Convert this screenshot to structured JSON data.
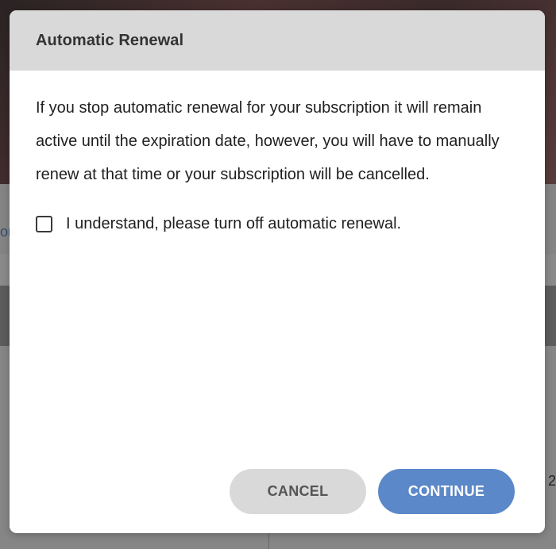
{
  "dialog": {
    "title": "Automatic Renewal",
    "message": "If you stop automatic renewal for your subscription it will remain active until the expiration date, however, you will have to manually renew at that time or your subscription will be cancelled.",
    "checkbox_label": "I understand, please turn off automatic renewal.",
    "checkbox_checked": false,
    "cancel_label": "CANCEL",
    "continue_label": "CONTINUE"
  },
  "background": {
    "partial_text_left": "or",
    "partial_text_right": "2"
  },
  "colors": {
    "header_bg": "#d9d9d9",
    "cancel_bg": "#d9d9d9",
    "continue_bg": "#5b88c8",
    "overlay": "#7a7a7a"
  }
}
